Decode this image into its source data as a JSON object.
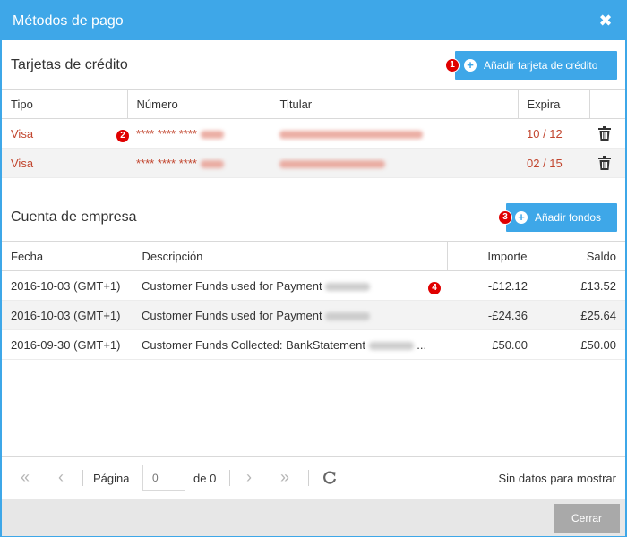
{
  "dialog": {
    "title": "Métodos de pago",
    "close_icon": "close-icon"
  },
  "cards": {
    "section_title": "Tarjetas de crédito",
    "add_button": "Añadir tarjeta de crédito",
    "columns": [
      "Tipo",
      "Número",
      "Titular",
      "Expira"
    ],
    "rows": [
      {
        "type": "Visa",
        "number": "**** **** ****",
        "expiry": "10 / 12"
      },
      {
        "type": "Visa",
        "number": "**** **** ****",
        "expiry": "02 / 15"
      }
    ],
    "accent_color": "#c2462f"
  },
  "company": {
    "section_title": "Cuenta de empresa",
    "add_button": "Añadir fondos",
    "columns": [
      "Fecha",
      "Descripción",
      "Importe",
      "Saldo"
    ],
    "rows": [
      {
        "date": "2016-10-03 (GMT+1)",
        "description": "Customer Funds used for Payment",
        "amount": "-£12.12",
        "balance": "£13.52"
      },
      {
        "date": "2016-10-03 (GMT+1)",
        "description": "Customer Funds used for Payment",
        "amount": "-£24.36",
        "balance": "£25.64"
      },
      {
        "date": "2016-09-30 (GMT+1)",
        "description": "Customer Funds Collected: BankStatement",
        "ellipsis": "...",
        "amount": "£50.00",
        "balance": "£50.00"
      }
    ]
  },
  "pager": {
    "page_label": "Página",
    "page_value": "0",
    "of_label": "de 0",
    "no_data": "Sin datos para mostrar"
  },
  "footer": {
    "close_button": "Cerrar"
  },
  "badges": [
    "1",
    "2",
    "3",
    "4"
  ],
  "colors": {
    "brand": "#3ea7e8",
    "badge": "#e00000",
    "close_button": "#a9a9a9"
  }
}
